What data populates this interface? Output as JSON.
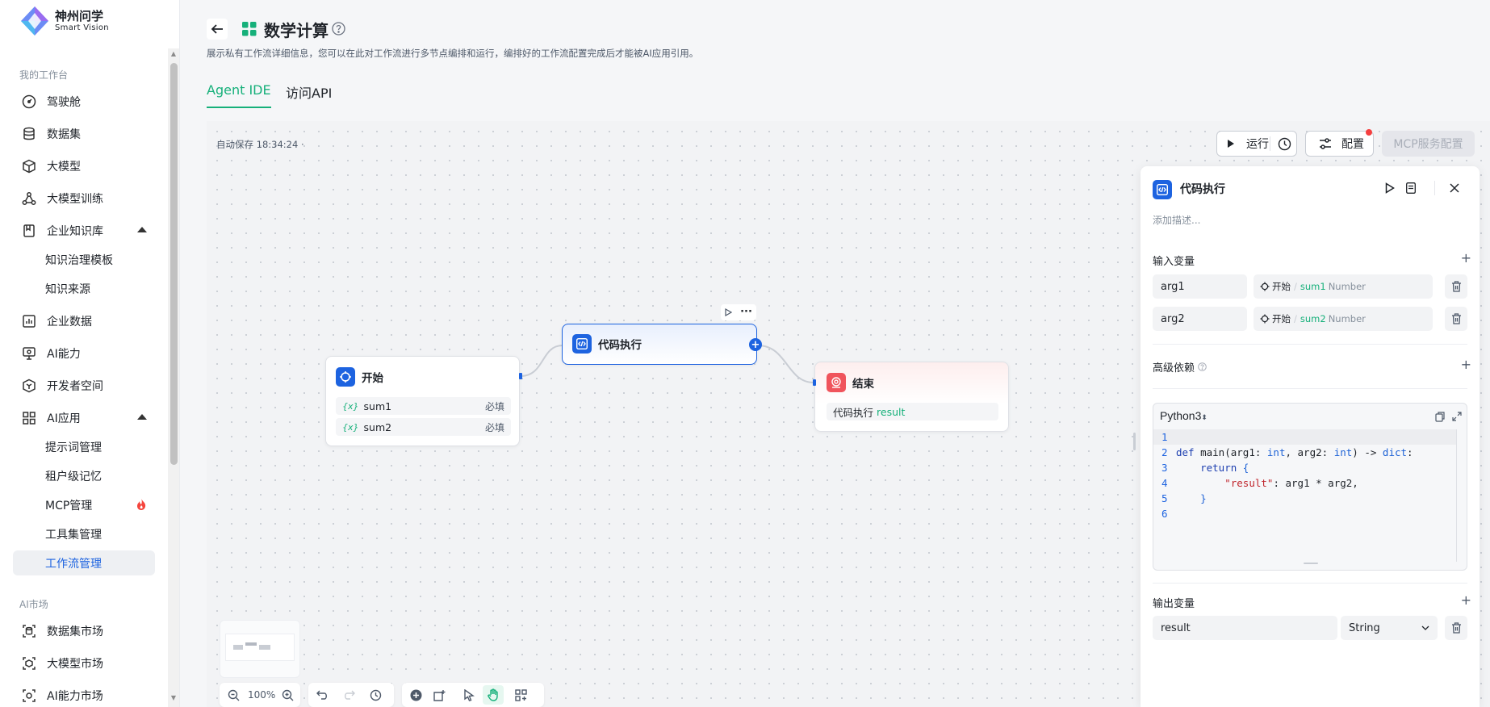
{
  "brand": {
    "name": "神州问学",
    "sub": "Smart Vision"
  },
  "sidebar": {
    "section_workspace": "我的工作台",
    "items": [
      {
        "label": "驾驶舱",
        "icon": "gauge-icon"
      },
      {
        "label": "数据集",
        "icon": "database-icon"
      },
      {
        "label": "大模型",
        "icon": "cube-icon"
      },
      {
        "label": "大模型训练",
        "icon": "training-icon"
      },
      {
        "label": "企业知识库",
        "icon": "book-icon"
      },
      {
        "label": "企业数据",
        "icon": "bar-chart-icon"
      },
      {
        "label": "AI能力",
        "icon": "monitor-icon"
      },
      {
        "label": "开发者空间",
        "icon": "hex-icon"
      },
      {
        "label": "AI应用",
        "icon": "grid-icon"
      }
    ],
    "knowledge_sub": [
      "知识治理模板",
      "知识来源"
    ],
    "app_sub": [
      "提示词管理",
      "租户级记忆",
      "MCP管理",
      "工具集管理",
      "工作流管理"
    ],
    "section_market": "AI市场",
    "market_items": [
      {
        "label": "数据集市场",
        "icon": "dataset-market-icon"
      },
      {
        "label": "大模型市场",
        "icon": "model-market-icon"
      },
      {
        "label": "AI能力市场",
        "icon": "ai-market-icon"
      }
    ]
  },
  "header": {
    "title": "数学计算",
    "description": "展示私有工作流详细信息，您可以在此对工作流进行多节点编排和运行，编排好的工作流配置完成后才能被AI应用引用。",
    "tabs": [
      "Agent IDE",
      "访问API"
    ]
  },
  "toolbar": {
    "autosave": "自动保存 18:34:24 ·",
    "run": "运行",
    "config": "配置",
    "mcp": "MCP服务配置"
  },
  "nodes": {
    "start": {
      "title": "开始",
      "vars": [
        {
          "name": "sum1",
          "req": "必填"
        },
        {
          "name": "sum2",
          "req": "必填"
        }
      ]
    },
    "code": {
      "title": "代码执行"
    },
    "end": {
      "title": "结束",
      "output_src": "代码执行",
      "output_var": "result"
    }
  },
  "panel": {
    "title": "代码执行",
    "desc_placeholder": "添加描述...",
    "inputs_label": "输入变量",
    "inputs": [
      {
        "name": "arg1",
        "src_node": "开始",
        "sep": "/",
        "src_var": "sum1",
        "type": "Number"
      },
      {
        "name": "arg2",
        "src_node": "开始",
        "sep": "/",
        "src_var": "sum2",
        "type": "Number"
      }
    ],
    "deps_label": "高级依赖",
    "language": "Python3",
    "code_lines": [
      "",
      "def main(arg1: int, arg2: int) -> dict:",
      "    return {",
      "        \"result\": arg1 * arg2,",
      "    }",
      ""
    ],
    "outputs_label": "输出变量",
    "outputs": [
      {
        "name": "result",
        "type": "String"
      }
    ]
  },
  "zoom": "100%",
  "colors": {
    "accent": "#16b07a",
    "primary": "#1d63e0",
    "end_node": "#f0545c"
  }
}
